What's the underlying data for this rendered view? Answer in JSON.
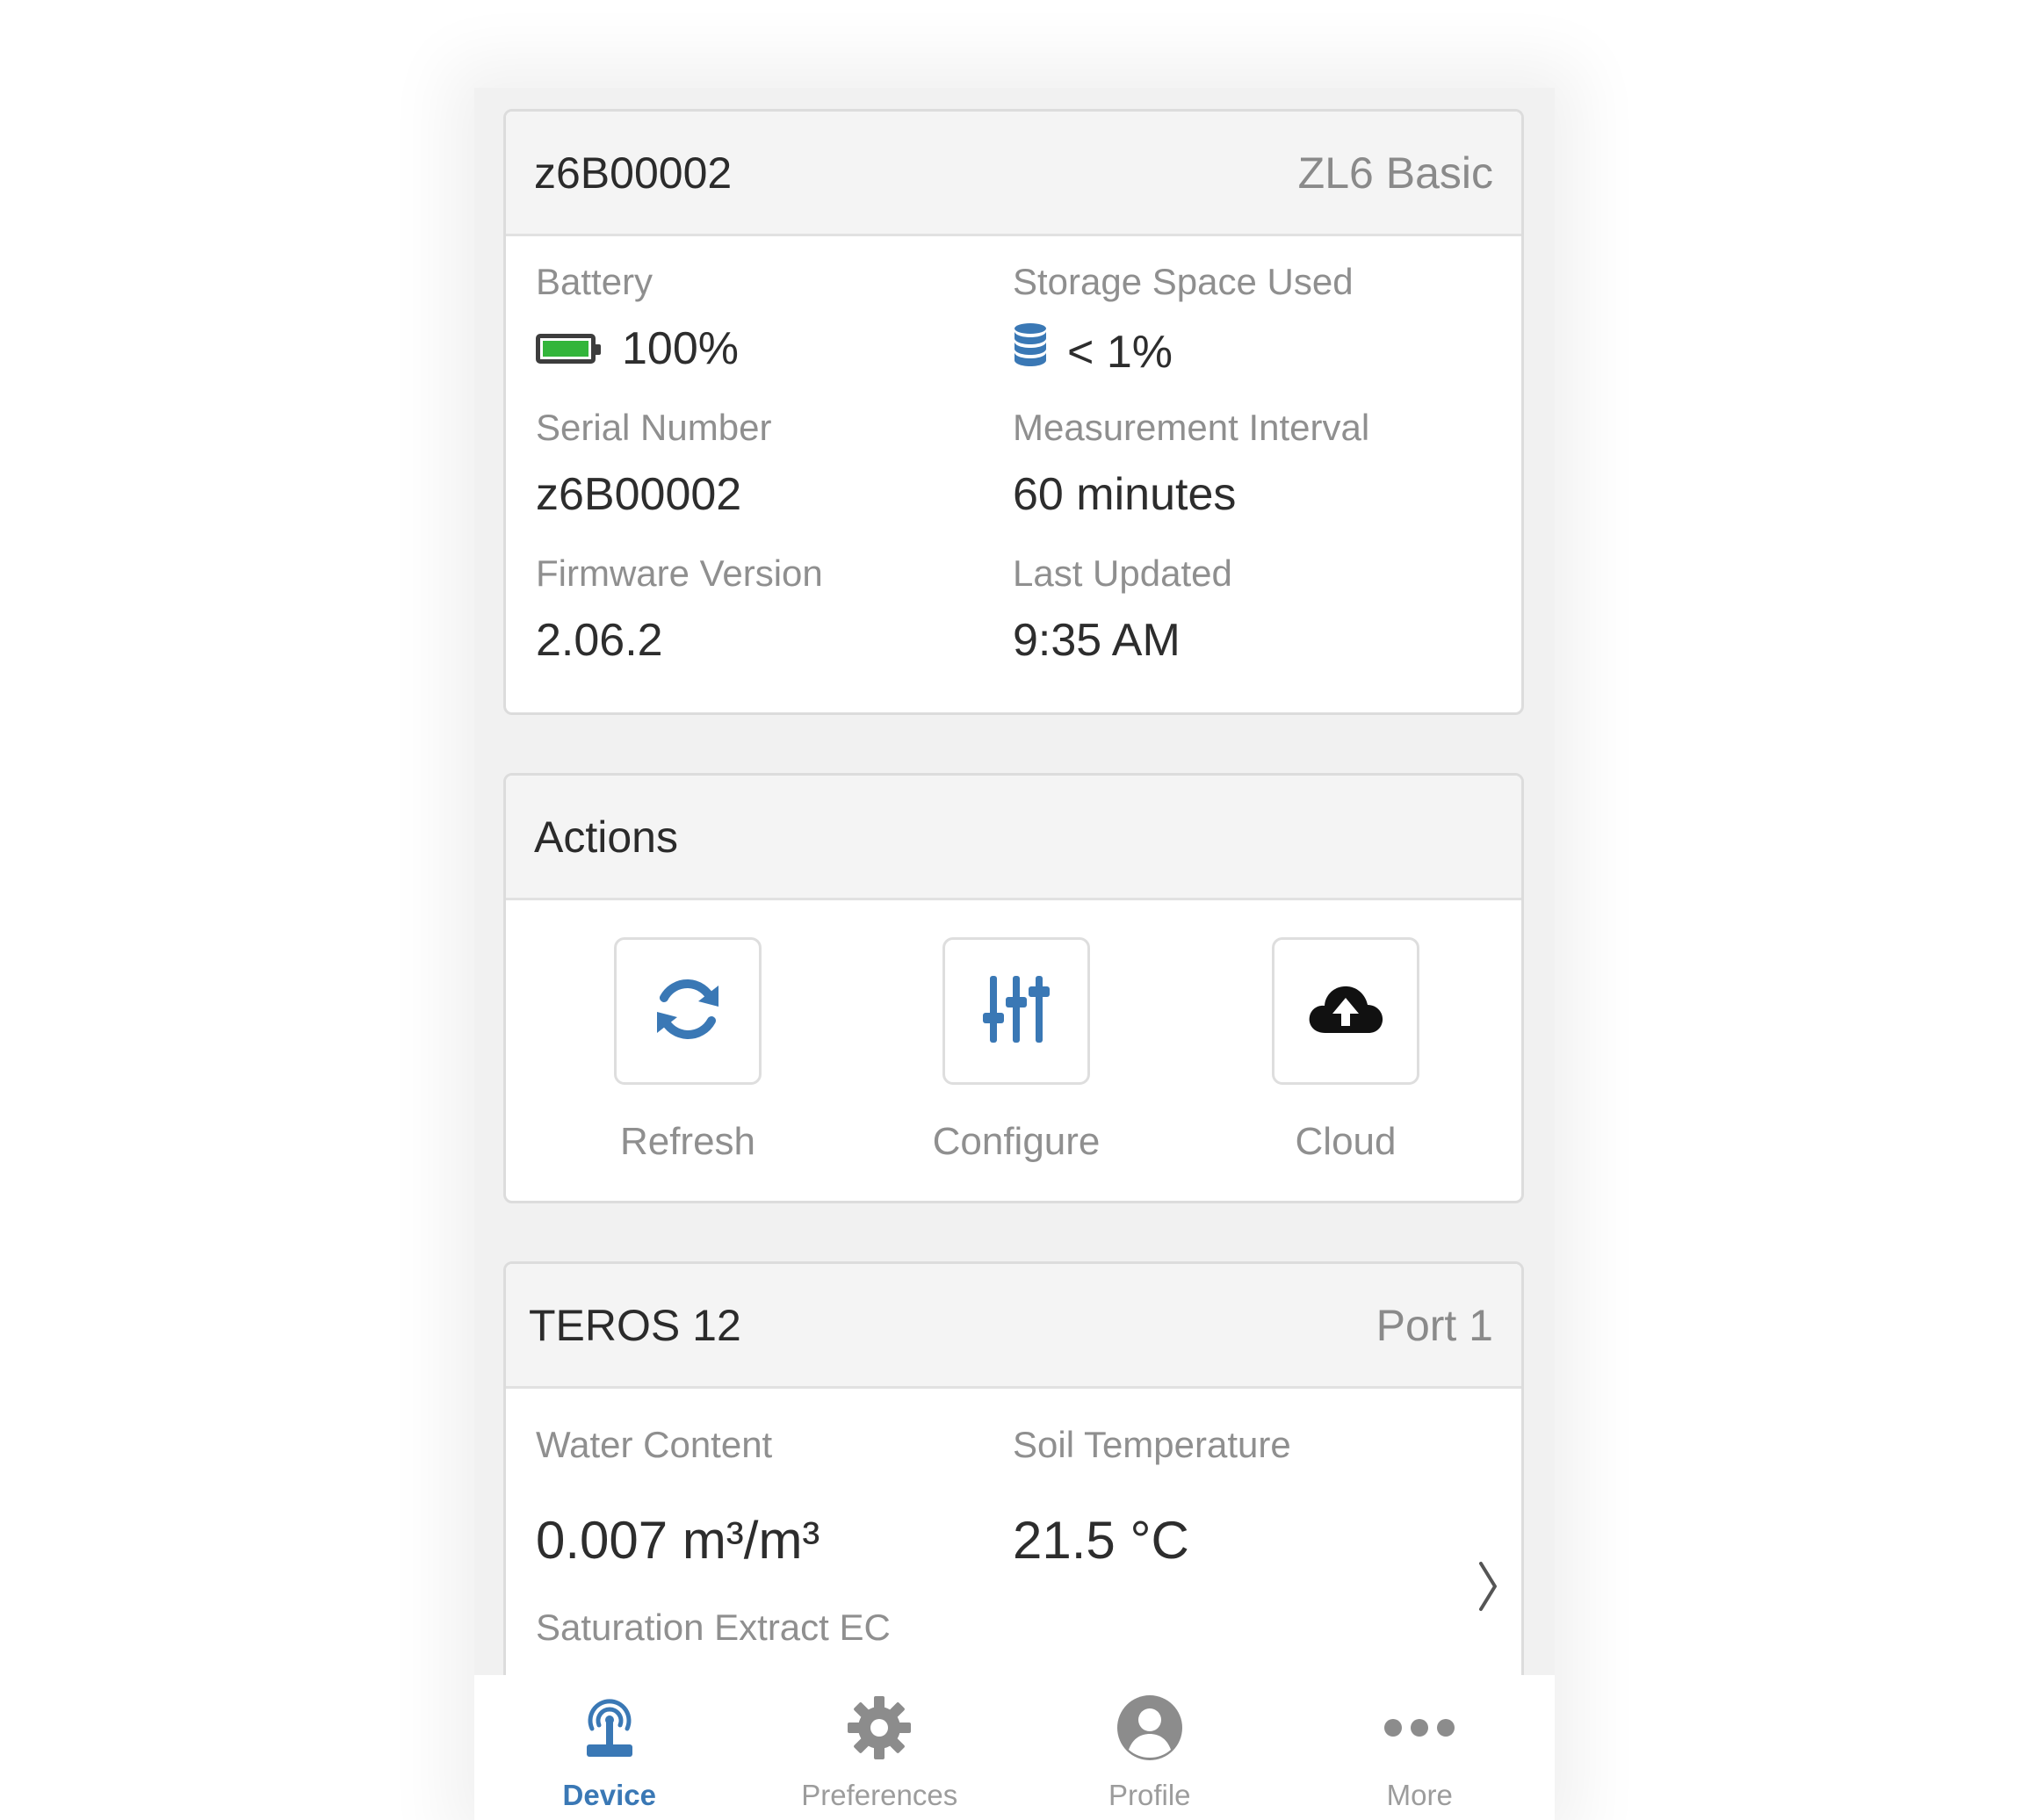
{
  "device": {
    "name": "z6B00002",
    "model": "ZL6 Basic",
    "fields": {
      "battery": {
        "label": "Battery",
        "value": "100%",
        "level_fraction": 1.0
      },
      "storage": {
        "label": "Storage Space Used",
        "value": "< 1%"
      },
      "serial": {
        "label": "Serial Number",
        "value": "z6B00002"
      },
      "interval": {
        "label": "Measurement Interval",
        "value": "60 minutes"
      },
      "firmware": {
        "label": "Firmware Version",
        "value": "2.06.2"
      },
      "updated": {
        "label": "Last Updated",
        "value": "9:35 AM"
      }
    }
  },
  "actions": {
    "title": "Actions",
    "items": [
      {
        "label": "Refresh",
        "icon": "refresh-icon"
      },
      {
        "label": "Configure",
        "icon": "sliders-icon"
      },
      {
        "label": "Cloud",
        "icon": "cloud-upload-icon"
      }
    ]
  },
  "sensor": {
    "name": "TEROS 12",
    "port": "Port 1",
    "fields": {
      "water_content": {
        "label": "Water Content",
        "value": "0.007 m³/m³"
      },
      "soil_temp": {
        "label": "Soil Temperature",
        "value": "21.5 °C"
      },
      "ec": {
        "label": "Saturation Extract EC"
      }
    }
  },
  "tabs": [
    {
      "label": "Device",
      "icon": "device-antenna-icon",
      "active": true
    },
    {
      "label": "Preferences",
      "icon": "gear-icon",
      "active": false
    },
    {
      "label": "Profile",
      "icon": "profile-icon",
      "active": false
    },
    {
      "label": "More",
      "icon": "more-dots-icon",
      "active": false
    }
  ],
  "colors": {
    "accent_blue": "#3a78b5",
    "battery_green": "#33b53a",
    "label_gray": "#8f8f8f",
    "text_dark": "#2d2d2d"
  }
}
